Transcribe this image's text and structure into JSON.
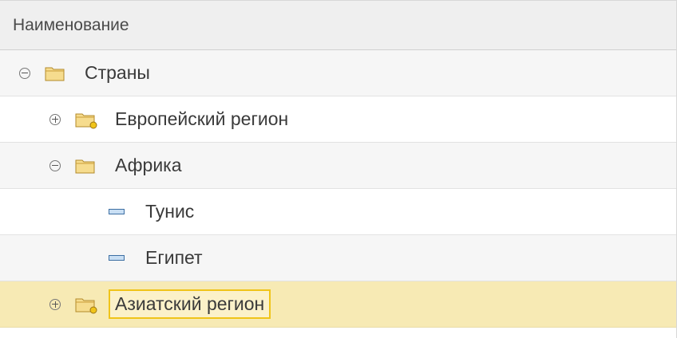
{
  "header": {
    "column_title": "Наименование"
  },
  "tree": [
    {
      "label": "Страны",
      "expanded": true,
      "type": "group"
    },
    {
      "label": "Европейский регион",
      "expanded": false,
      "type": "group-with-items"
    },
    {
      "label": "Африка",
      "expanded": true,
      "type": "group"
    },
    {
      "label": "Тунис",
      "type": "item"
    },
    {
      "label": "Египет",
      "type": "item"
    },
    {
      "label": "Азиатский регион",
      "expanded": false,
      "type": "group-with-items",
      "selected": true
    }
  ],
  "colors": {
    "selection": "#f7eab4",
    "focus_border": "#f0c419",
    "folder": "#f3d27a",
    "item_icon": "#3d6fa3"
  },
  "icons": {
    "collapse": "minus-circle-icon",
    "expand": "plus-circle-icon",
    "folder": "folder-icon",
    "folder_with_items": "folder-with-items-icon",
    "item": "catalog-item-icon"
  }
}
